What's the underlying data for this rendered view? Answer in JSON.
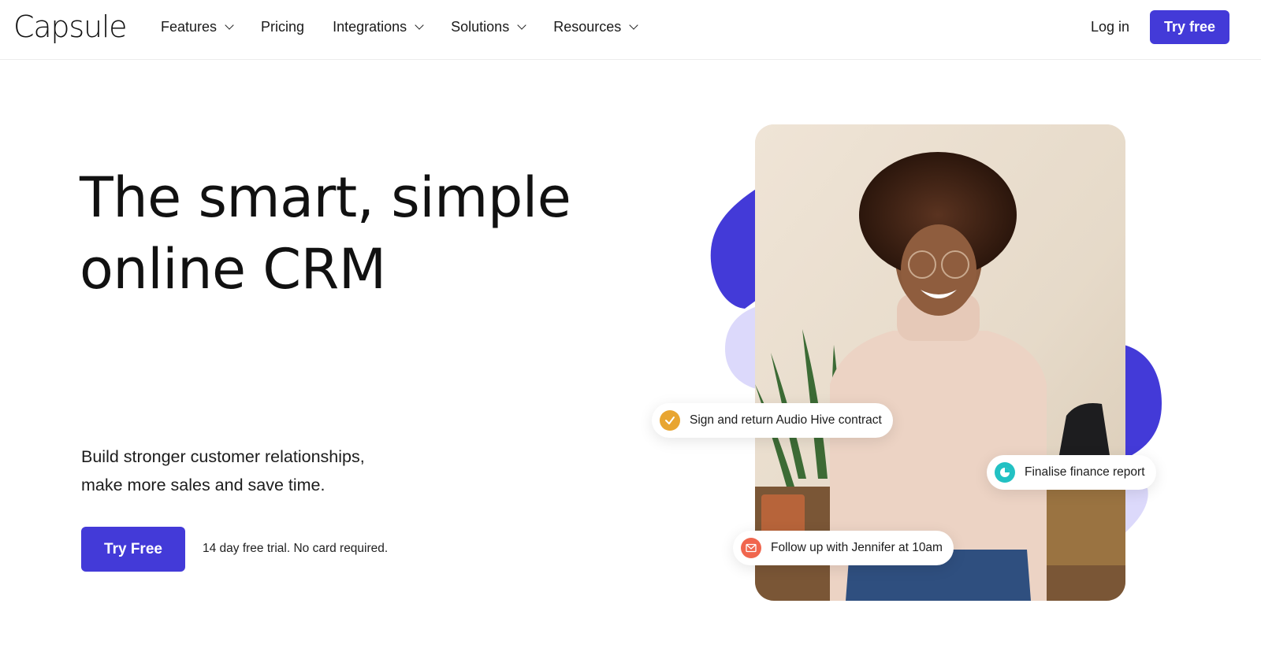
{
  "header": {
    "logo": "Capsule",
    "nav": [
      {
        "label": "Features",
        "has_dropdown": true
      },
      {
        "label": "Pricing",
        "has_dropdown": false
      },
      {
        "label": "Integrations",
        "has_dropdown": true
      },
      {
        "label": "Solutions",
        "has_dropdown": true
      },
      {
        "label": "Resources",
        "has_dropdown": true
      }
    ],
    "login_label": "Log in",
    "try_free_label": "Try free"
  },
  "hero": {
    "title_lines": [
      "The smart, simple",
      "online CRM"
    ],
    "subtitle_lines": [
      "Build stronger customer relationships,",
      "make more sales and save time."
    ],
    "cta_label": "Try Free",
    "cta_note": "14 day free trial. No card required."
  },
  "visual": {
    "tasks": [
      {
        "label": "Sign and return Audio Hive contract",
        "icon": "check-icon",
        "icon_color": "#e8a531"
      },
      {
        "label": "Finalise finance report",
        "icon": "pie-chart-icon",
        "icon_color": "#22c1c3"
      },
      {
        "label": "Follow up with Jennifer at 10am",
        "icon": "mail-icon",
        "icon_color": "#f0664e"
      }
    ]
  },
  "colors": {
    "brand": "#433ad8",
    "blob_light": "#dcd9fb"
  }
}
